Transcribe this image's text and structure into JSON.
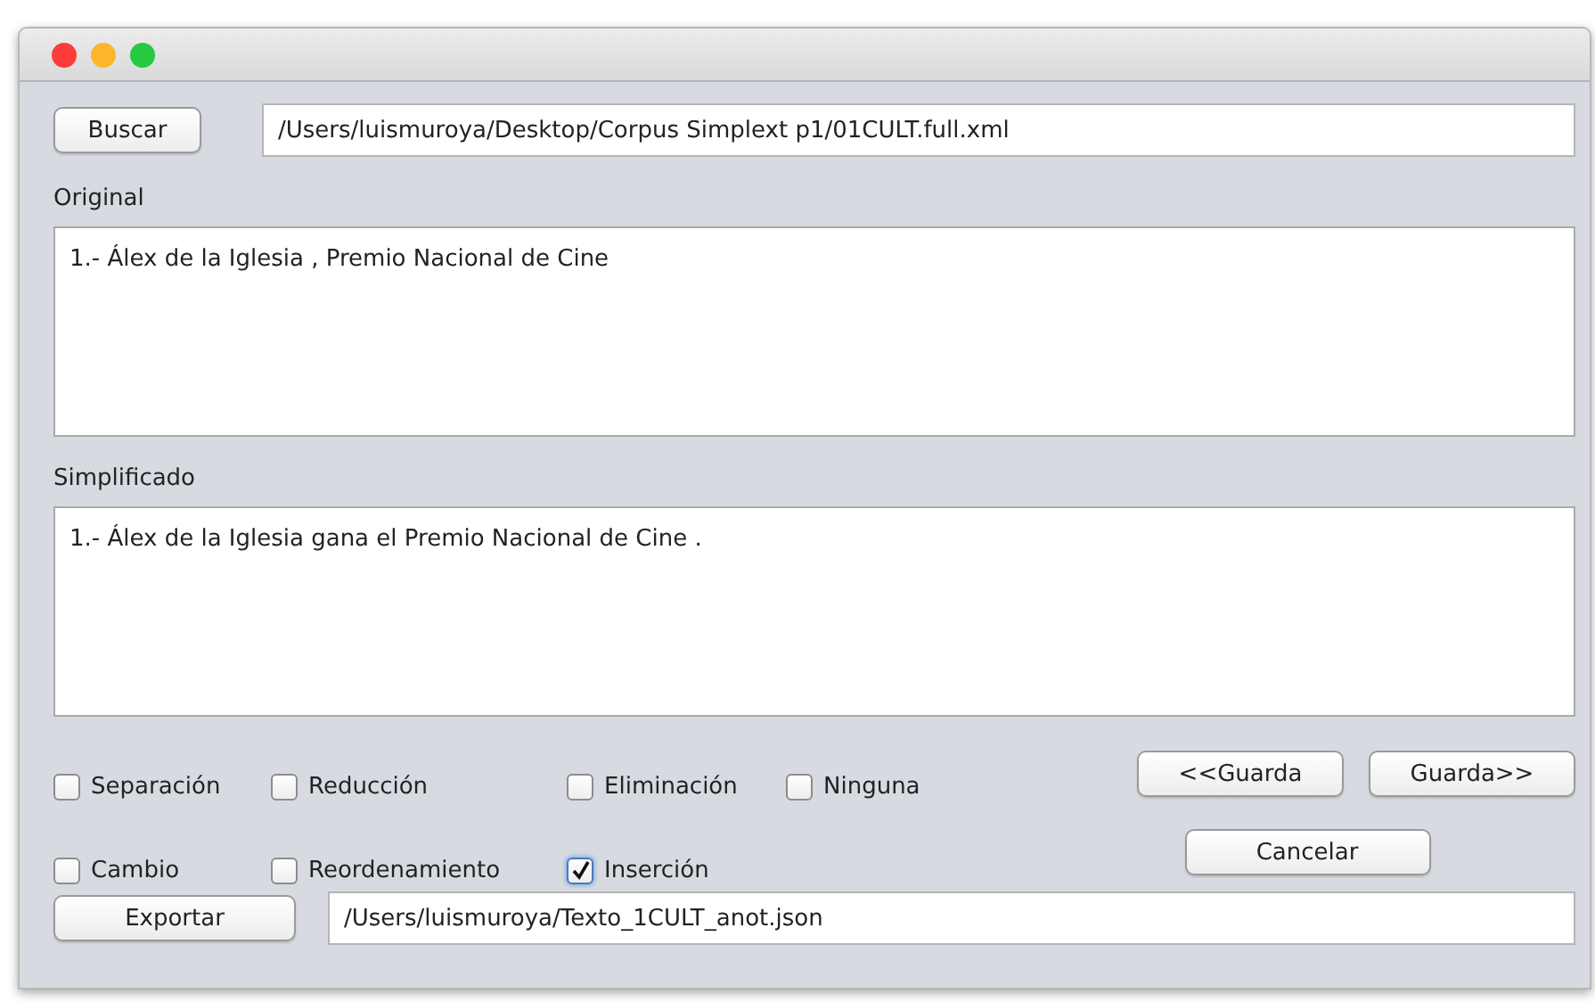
{
  "window": {
    "controls": [
      {
        "color": "#fc3d39"
      },
      {
        "color": "#fdb52b"
      },
      {
        "color": "#27c940"
      }
    ]
  },
  "search": {
    "button": "Buscar",
    "path": "/Users/luismuroya/Desktop/Corpus Simplext p1/01CULT.full.xml"
  },
  "original": {
    "label": "Original",
    "text": "1.- Álex de la Iglesia , Premio Nacional de Cine"
  },
  "simplified": {
    "label": "Simplificado",
    "text": "1.- Álex de la Iglesia gana el Premio Nacional de Cine ."
  },
  "checkbox_rows": [
    [
      {
        "label": "Separación",
        "checked": false
      },
      {
        "label": "Reducción",
        "checked": false
      },
      {
        "label": "Eliminación",
        "checked": false
      },
      {
        "label": "Ninguna",
        "checked": false
      }
    ],
    [
      {
        "label": "Cambio",
        "checked": false
      },
      {
        "label": "Reordenamiento",
        "checked": false
      },
      {
        "label": "Inserción",
        "checked": true
      }
    ]
  ],
  "nav_buttons": [
    "<<Guarda",
    "Guarda>>"
  ],
  "cancel_button": "Cancelar",
  "export": {
    "button": "Exportar",
    "path": "/Users/luismuroya/Texto_1CULT_anot.json"
  }
}
